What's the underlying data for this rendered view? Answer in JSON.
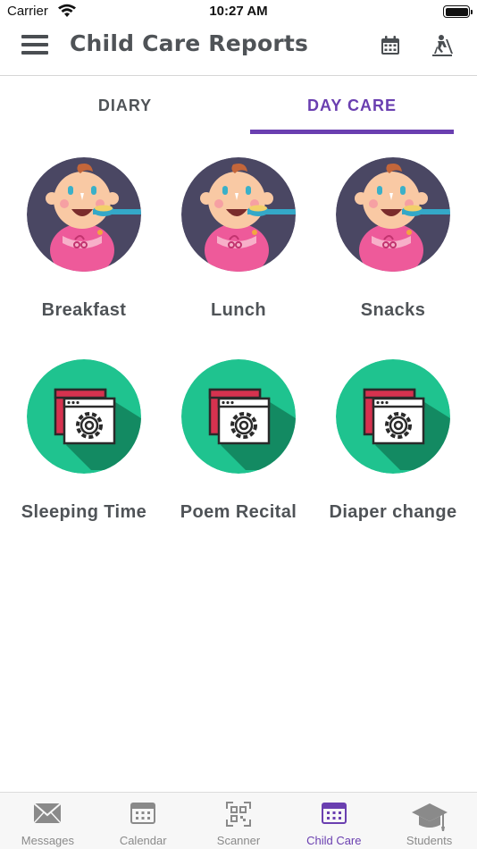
{
  "status_bar": {
    "carrier": "Carrier",
    "time": "10:27 AM"
  },
  "header": {
    "title": "Child Care Reports",
    "icons": [
      "calendar-icon",
      "student-activity-icon"
    ]
  },
  "tabs": [
    {
      "label": "DIARY",
      "active": false
    },
    {
      "label": "DAY CARE",
      "active": true
    }
  ],
  "items": [
    {
      "label": "Breakfast",
      "icon": "baby-feeding-icon"
    },
    {
      "label": "Lunch",
      "icon": "baby-feeding-icon"
    },
    {
      "label": "Snacks",
      "icon": "baby-feeding-icon"
    },
    {
      "label": "Sleeping Time",
      "icon": "settings-window-icon"
    },
    {
      "label": "Poem Recital",
      "icon": "settings-window-icon"
    },
    {
      "label": "Diaper change",
      "icon": "settings-window-icon"
    }
  ],
  "tabbar": [
    {
      "label": "Messages",
      "icon": "envelope-icon",
      "active": false
    },
    {
      "label": "Calendar",
      "icon": "calendar-icon",
      "active": false
    },
    {
      "label": "Scanner",
      "icon": "qr-scanner-icon",
      "active": false
    },
    {
      "label": "Child Care",
      "icon": "calendar-grid-icon",
      "active": true
    },
    {
      "label": "Students",
      "icon": "graduation-cap-icon",
      "active": false
    }
  ],
  "colors": {
    "accent": "#6a3fb0",
    "text": "#4f5357",
    "icon_green": "#1fc38f",
    "icon_dark_purple": "#4a4763",
    "bib_pink": "#ee5a9a"
  }
}
